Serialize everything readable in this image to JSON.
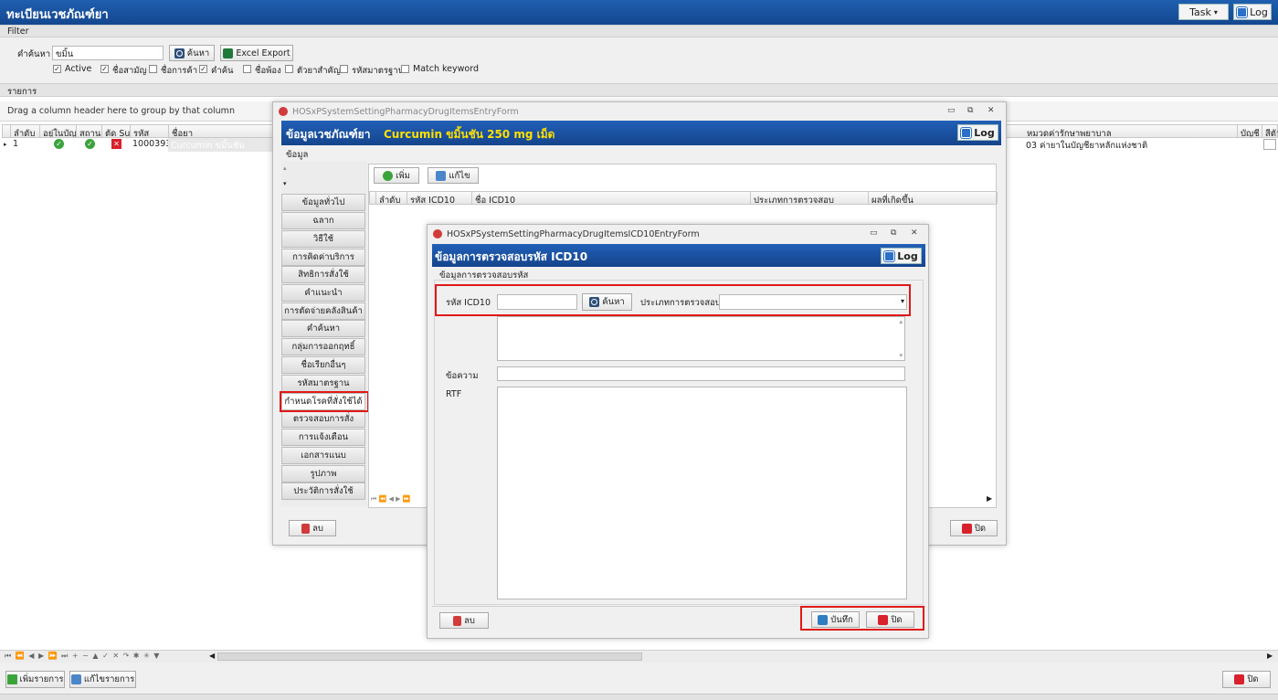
{
  "app": {
    "title": "ทะเบียนเวชภัณฑ์ยา",
    "task_label": "Task",
    "log_label": "Log"
  },
  "filter": {
    "section_label": "Filter",
    "search_label": "คำค้นหา",
    "search_value": "ขมิ้น",
    "search_button": "ค้นหา",
    "excel_button": "Excel Export",
    "checkboxes": [
      {
        "label": "Active",
        "checked": true
      },
      {
        "label": "ชื่อสามัญ",
        "checked": true
      },
      {
        "label": "ชื่อการค้า",
        "checked": false
      },
      {
        "label": "คำค้น",
        "checked": true
      },
      {
        "label": "ชื่อพ้อง",
        "checked": false
      },
      {
        "label": "ตัวยาสำคัญ",
        "checked": false
      },
      {
        "label": "รหัสมาตรฐาน",
        "checked": false
      },
      {
        "label": "Match keyword",
        "checked": false
      }
    ]
  },
  "list": {
    "section_label": "รายการ",
    "group_hint": "Drag a column header here to group by that column",
    "columns": [
      "ลำดับ",
      "อยู่ในบัญ",
      "สถานะ",
      "ตัด Sub",
      "รหัส",
      "ชื่อยา"
    ],
    "right_columns": [
      "หมวดค่ารักษาพยาบาล",
      "บัญชี",
      "สีตัว"
    ],
    "row": {
      "order": "1",
      "code": "1000393",
      "name": "Curcumin ขมิ้นชัน",
      "category": "03 ค่ายาในบัญชียาหลักแห่งชาติ"
    }
  },
  "bottom": {
    "add_button": "เพิ่มรายการ",
    "edit_button": "แก้ไขรายการ",
    "close_button": "ปิด",
    "nav_symbols": "⏮ ⏪ ◀ ▶ ⏩ ⏭ + − ▲ ✓ ✕ ↷ ✱ ✳ ▼"
  },
  "entry_form": {
    "window_title": "HOSxPSystemSettingPharmacyDrugItemsEntryForm",
    "header_label": "ข้อมูลเวชภัณฑ์ยา",
    "drug_name": "Curcumin ขมิ้นชัน 250 mg เม็ด",
    "log_label": "Log",
    "tab_label": "ข้อมูล",
    "nav_items": [
      "ข้อมูลทั่วไป",
      "ฉลาก",
      "วิธีใช้",
      "การคิดค่าบริการ",
      "สิทธิการสั่งใช้",
      "คำแนะนำ",
      "การตัดจ่ายคลังสินค้า",
      "คำค้นหา",
      "กลุ่มการออกฤทธิ์",
      "ชื่อเรียกอื่นๆ",
      "รหัสมาตรฐาน",
      "กำหนดโรคที่สั่งใช้ได้",
      "ตรวจสอบการสั่ง",
      "การแจ้งเตือน",
      "เอกสารแนบ",
      "รูปภาพ",
      "ประวัติการสั่งใช้"
    ],
    "add_button": "เพิ่ม",
    "edit_button": "แก้ไข",
    "grid_columns": [
      "ลำดับ",
      "รหัส ICD10",
      "ชื่อ ICD10",
      "ประเภทการตรวจสอบ",
      "ผลที่เกิดขึ้น"
    ],
    "delete_button": "ลบ",
    "close_button": "ปิด"
  },
  "icd_form": {
    "window_title": "HOSxPSystemSettingPharmacyDrugItemsICD10EntryForm",
    "header_label": "ข้อมูลการตรวจสอบรหัส ICD10",
    "log_label": "Log",
    "group_label": "ข้อมูลการตรวจสอบรหัส",
    "code_label": "รหัส ICD10",
    "code_value": "",
    "search_button": "ค้นหา",
    "type_label": "ประเภทการตรวจสอบ",
    "type_value": "",
    "message_label": "ข้อความ",
    "rtf_label": "RTF",
    "delete_button": "ลบ",
    "save_button": "บันทึก",
    "close_button": "ปิด"
  },
  "colors": {
    "header_blue": "#1a56a8",
    "highlight_red": "#e01919",
    "drug_yellow": "#ffe000"
  }
}
